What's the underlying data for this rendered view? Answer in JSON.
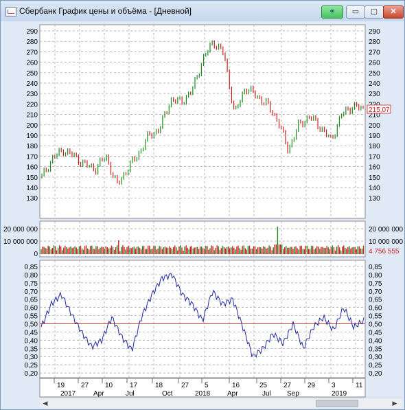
{
  "window": {
    "title": "Сбербанк График цены и объёма - [Дневной]",
    "buttons": {
      "link": "⚭",
      "minimize": "▭",
      "maximize": "▢",
      "close": "✕"
    }
  },
  "colors": {
    "up": "#1a8a1a",
    "down": "#cc1f1f",
    "osc": "#1f2a9c",
    "midline": "#c0392b",
    "grid": "#9a9a9a"
  },
  "price_axis": {
    "labels": [
      "290",
      "280",
      "270",
      "260",
      "250",
      "240",
      "230",
      "220",
      "210",
      "200",
      "190",
      "180",
      "170",
      "160",
      "150",
      "140",
      "130"
    ],
    "last": "215,07"
  },
  "volume_axis": {
    "labels": [
      "20 000 000",
      "10 000 000",
      "0"
    ],
    "last": "4 756 555"
  },
  "osc_axis": {
    "labels": [
      "0,85",
      "0,80",
      "0,75",
      "0,70",
      "0,65",
      "0,60",
      "0,55",
      "0,50",
      "0,45",
      "0,40",
      "0,35",
      "0,30",
      "0,25",
      "0,20"
    ]
  },
  "date_axis": {
    "days": [
      "19",
      "27",
      "10",
      "17",
      "18",
      "27",
      "5",
      "16",
      "25",
      "27",
      "29",
      "3",
      "11"
    ],
    "months": [
      "2017",
      "Apr",
      "Jul",
      "Oct",
      "2018",
      "Apr",
      "Jul",
      "Sep",
      "2019"
    ]
  },
  "chart_data": {
    "type": "line",
    "price": {
      "ylim": [
        128,
        295
      ],
      "x_months": [
        0,
        1,
        2,
        3,
        4,
        5,
        6,
        7,
        8,
        9,
        10,
        11,
        12,
        13,
        14,
        15,
        16,
        17,
        18,
        19,
        20,
        21,
        22,
        23,
        24,
        25
      ],
      "close": [
        150,
        168,
        176,
        170,
        162,
        158,
        170,
        142,
        158,
        172,
        190,
        196,
        224,
        222,
        232,
        262,
        280,
        268,
        210,
        236,
        228,
        220,
        205,
        176,
        200,
        208,
        198,
        185,
        210,
        218,
        215
      ]
    },
    "volume": {
      "ylim": [
        0,
        22000000
      ],
      "spike_month": 18,
      "spike_value": 20000000,
      "typical": 4500000
    },
    "oscillator": {
      "ylim": [
        0.18,
        0.87
      ],
      "midline": 0.5,
      "values": [
        0.48,
        0.62,
        0.68,
        0.56,
        0.45,
        0.36,
        0.4,
        0.54,
        0.42,
        0.34,
        0.55,
        0.68,
        0.78,
        0.8,
        0.68,
        0.62,
        0.52,
        0.7,
        0.62,
        0.65,
        0.48,
        0.3,
        0.35,
        0.44,
        0.38,
        0.5,
        0.35,
        0.48,
        0.54,
        0.46,
        0.6,
        0.48,
        0.52
      ]
    }
  }
}
